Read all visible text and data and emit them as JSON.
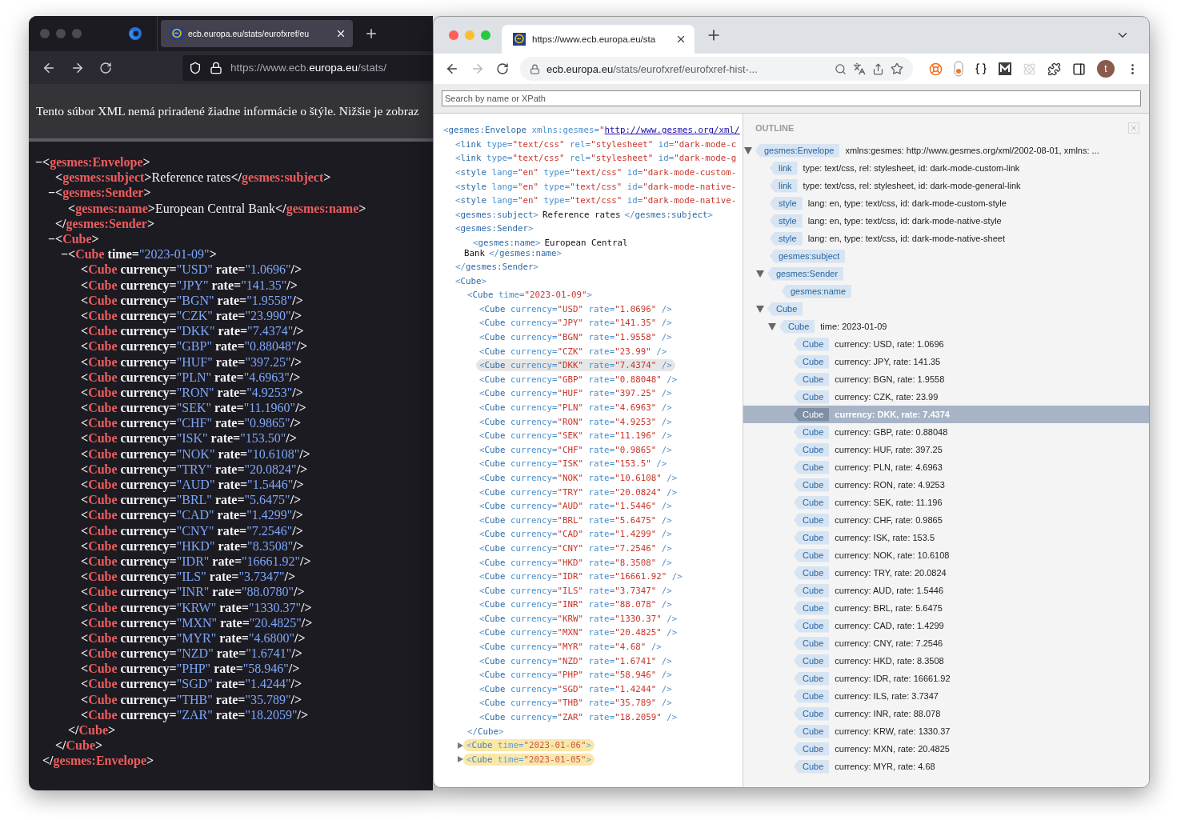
{
  "firefox": {
    "tab_title": "ecb.europa.eu/stats/eurofxref/eu",
    "url": {
      "prefix": "https://www.ecb.",
      "domain": "europa.eu",
      "suffix": "/stats/"
    },
    "notice": "Tento súbor XML nemá priradené žiadne informácie o štýle. Nižšie je zobraz",
    "xml": {
      "toggle": "−",
      "line": "<gesmes:Envelope>",
      "close": "</gesmes:Envelope>",
      "children": [
        {
          "line": "<gesmes:subject>Reference rates</gesmes:subject>"
        },
        {
          "toggle": "−",
          "line": "<gesmes:Sender>",
          "close": "</gesmes:Sender>",
          "children": [
            {
              "line": "<gesmes:name>European Central Bank</gesmes:name>"
            }
          ]
        },
        {
          "toggle": "−",
          "line": "<Cube>",
          "close": "</Cube>",
          "children": [
            {
              "toggle": "−",
              "line": "<Cube time=\"2023-01-09\">",
              "close": "</Cube>",
              "children": [
                {
                  "line": "<Cube currency=\"USD\" rate=\"1.0696\"/>"
                },
                {
                  "line": "<Cube currency=\"JPY\" rate=\"141.35\"/>"
                },
                {
                  "line": "<Cube currency=\"BGN\" rate=\"1.9558\"/>"
                },
                {
                  "line": "<Cube currency=\"CZK\" rate=\"23.990\"/>"
                },
                {
                  "line": "<Cube currency=\"DKK\" rate=\"7.4374\"/>"
                },
                {
                  "line": "<Cube currency=\"GBP\" rate=\"0.88048\"/>"
                },
                {
                  "line": "<Cube currency=\"HUF\" rate=\"397.25\"/>"
                },
                {
                  "line": "<Cube currency=\"PLN\" rate=\"4.6963\"/>"
                },
                {
                  "line": "<Cube currency=\"RON\" rate=\"4.9253\"/>"
                },
                {
                  "line": "<Cube currency=\"SEK\" rate=\"11.1960\"/>"
                },
                {
                  "line": "<Cube currency=\"CHF\" rate=\"0.9865\"/>"
                },
                {
                  "line": "<Cube currency=\"ISK\" rate=\"153.50\"/>"
                },
                {
                  "line": "<Cube currency=\"NOK\" rate=\"10.6108\"/>"
                },
                {
                  "line": "<Cube currency=\"TRY\" rate=\"20.0824\"/>"
                },
                {
                  "line": "<Cube currency=\"AUD\" rate=\"1.5446\"/>"
                },
                {
                  "line": "<Cube currency=\"BRL\" rate=\"5.6475\"/>"
                },
                {
                  "line": "<Cube currency=\"CAD\" rate=\"1.4299\"/>"
                },
                {
                  "line": "<Cube currency=\"CNY\" rate=\"7.2546\"/>"
                },
                {
                  "line": "<Cube currency=\"HKD\" rate=\"8.3508\"/>"
                },
                {
                  "line": "<Cube currency=\"IDR\" rate=\"16661.92\"/>"
                },
                {
                  "line": "<Cube currency=\"ILS\" rate=\"3.7347\"/>"
                },
                {
                  "line": "<Cube currency=\"INR\" rate=\"88.0780\"/>"
                },
                {
                  "line": "<Cube currency=\"KRW\" rate=\"1330.37\"/>"
                },
                {
                  "line": "<Cube currency=\"MXN\" rate=\"20.4825\"/>"
                },
                {
                  "line": "<Cube currency=\"MYR\" rate=\"4.6800\"/>"
                },
                {
                  "line": "<Cube currency=\"NZD\" rate=\"1.6741\"/>"
                },
                {
                  "line": "<Cube currency=\"PHP\" rate=\"58.946\"/>"
                },
                {
                  "line": "<Cube currency=\"SGD\" rate=\"1.4244\"/>"
                },
                {
                  "line": "<Cube currency=\"THB\" rate=\"35.789\"/>"
                },
                {
                  "line": "<Cube currency=\"ZAR\" rate=\"18.2059\"/>"
                }
              ]
            }
          ]
        }
      ]
    }
  },
  "chrome": {
    "tab_title": "https://www.ecb.europa.eu/sta",
    "forward_disabled": true,
    "host": "ecb.europa.eu",
    "path": "/stats/eurofxref/eurofxref-hist-...",
    "avatar": "t",
    "search_placeholder": "Search by name or XPath",
    "source": {
      "line": "<gesmes:Envelope xmlns:gesmes=\"",
      "link": "http://www.gesmes.org/xml/",
      "children": [
        {
          "line": "<link type=\"text/css\" rel=\"stylesheet\" id=\"dark-mode-c"
        },
        {
          "line": "<link type=\"text/css\" rel=\"stylesheet\" id=\"dark-mode-g"
        },
        {
          "line": "<style lang=\"en\" type=\"text/css\" id=\"dark-mode-custom-"
        },
        {
          "line": "<style lang=\"en\" type=\"text/css\" id=\"dark-mode-native-"
        },
        {
          "line": "<style lang=\"en\" type=\"text/css\" id=\"dark-mode-native-"
        },
        {
          "open": "<gesmes:subject>",
          "text": "Reference rates",
          "close": "</gesmes:subject>"
        },
        {
          "line": "<gesmes:Sender>",
          "close": "</gesmes:Sender>",
          "children": [
            {
              "open": "<gesmes:name>",
              "text": "European Central Bank",
              "close": "</gesmes:name>"
            }
          ]
        },
        {
          "line": "<Cube>",
          "children": [
            {
              "line": "<Cube time=\"2023-01-09\">",
              "expanded": true,
              "close": "</Cube>",
              "children": [
                {
                  "line": "<Cube currency=\"USD\" rate=\"1.0696\" />",
                  "selected": false
                },
                {
                  "line": "<Cube currency=\"JPY\" rate=\"141.35\" />",
                  "selected": false
                },
                {
                  "line": "<Cube currency=\"BGN\" rate=\"1.9558\" />",
                  "selected": false
                },
                {
                  "line": "<Cube currency=\"CZK\" rate=\"23.99\" />",
                  "selected": false
                },
                {
                  "line": "<Cube currency=\"DKK\" rate=\"7.4374\" />",
                  "selected": true
                },
                {
                  "line": "<Cube currency=\"GBP\" rate=\"0.88048\" />",
                  "selected": false
                },
                {
                  "line": "<Cube currency=\"HUF\" rate=\"397.25\" />",
                  "selected": false
                },
                {
                  "line": "<Cube currency=\"PLN\" rate=\"4.6963\" />",
                  "selected": false
                },
                {
                  "line": "<Cube currency=\"RON\" rate=\"4.9253\" />",
                  "selected": false
                },
                {
                  "line": "<Cube currency=\"SEK\" rate=\"11.196\" />",
                  "selected": false
                },
                {
                  "line": "<Cube currency=\"CHF\" rate=\"0.9865\" />",
                  "selected": false
                },
                {
                  "line": "<Cube currency=\"ISK\" rate=\"153.5\" />",
                  "selected": false
                },
                {
                  "line": "<Cube currency=\"NOK\" rate=\"10.6108\" />",
                  "selected": false
                },
                {
                  "line": "<Cube currency=\"TRY\" rate=\"20.0824\" />",
                  "selected": false
                },
                {
                  "line": "<Cube currency=\"AUD\" rate=\"1.5446\" />",
                  "selected": false
                },
                {
                  "line": "<Cube currency=\"BRL\" rate=\"5.6475\" />",
                  "selected": false
                },
                {
                  "line": "<Cube currency=\"CAD\" rate=\"1.4299\" />",
                  "selected": false
                },
                {
                  "line": "<Cube currency=\"CNY\" rate=\"7.2546\" />",
                  "selected": false
                },
                {
                  "line": "<Cube currency=\"HKD\" rate=\"8.3508\" />",
                  "selected": false
                },
                {
                  "line": "<Cube currency=\"IDR\" rate=\"16661.92\" />",
                  "selected": false
                },
                {
                  "line": "<Cube currency=\"ILS\" rate=\"3.7347\" />",
                  "selected": false
                },
                {
                  "line": "<Cube currency=\"INR\" rate=\"88.078\" />",
                  "selected": false
                },
                {
                  "line": "<Cube currency=\"KRW\" rate=\"1330.37\" />",
                  "selected": false
                },
                {
                  "line": "<Cube currency=\"MXN\" rate=\"20.4825\" />",
                  "selected": false
                },
                {
                  "line": "<Cube currency=\"MYR\" rate=\"4.68\" />",
                  "selected": false
                },
                {
                  "line": "<Cube currency=\"NZD\" rate=\"1.6741\" />",
                  "selected": false
                },
                {
                  "line": "<Cube currency=\"PHP\" rate=\"58.946\" />",
                  "selected": false
                },
                {
                  "line": "<Cube currency=\"SGD\" rate=\"1.4244\" />",
                  "selected": false
                },
                {
                  "line": "<Cube currency=\"THB\" rate=\"35.789\" />",
                  "selected": false
                },
                {
                  "line": "<Cube currency=\"ZAR\" rate=\"18.2059\" />",
                  "selected": false
                }
              ]
            },
            {
              "line": "<Cube time=\"2023-01-06\">",
              "expanded": false
            },
            {
              "line": "<Cube time=\"2023-01-05\">",
              "expanded": false
            }
          ]
        }
      ]
    },
    "outline": {
      "title": "OUTLINE",
      "tree": [
        {
          "tag": "gesmes:Envelope",
          "info": "xmlns:gesmes: http://www.gesmes.org/xml/2002-08-01, xmlns: ...",
          "expanded": true,
          "children": [
            {
              "tag": "link",
              "info": "type: text/css, rel: stylesheet, id: dark-mode-custom-link"
            },
            {
              "tag": "link",
              "info": "type: text/css, rel: stylesheet, id: dark-mode-general-link"
            },
            {
              "tag": "style",
              "info": "lang: en, type: text/css, id: dark-mode-custom-style"
            },
            {
              "tag": "style",
              "info": "lang: en, type: text/css, id: dark-mode-native-style"
            },
            {
              "tag": "style",
              "info": "lang: en, type: text/css, id: dark-mode-native-sheet"
            },
            {
              "tag": "gesmes:subject"
            },
            {
              "tag": "gesmes:Sender",
              "expanded": true,
              "children": [
                {
                  "tag": "gesmes:name"
                }
              ]
            },
            {
              "tag": "Cube",
              "expanded": true,
              "children": [
                {
                  "tag": "Cube",
                  "info": "time: 2023-01-09",
                  "expanded": true,
                  "children": [
                    {
                      "tag": "Cube",
                      "info": "currency: USD, rate: 1.0696",
                      "selected": false
                    },
                    {
                      "tag": "Cube",
                      "info": "currency: JPY, rate: 141.35",
                      "selected": false
                    },
                    {
                      "tag": "Cube",
                      "info": "currency: BGN, rate: 1.9558",
                      "selected": false
                    },
                    {
                      "tag": "Cube",
                      "info": "currency: CZK, rate: 23.99",
                      "selected": false
                    },
                    {
                      "tag": "Cube",
                      "info": "currency: DKK, rate: 7.4374",
                      "selected": true
                    },
                    {
                      "tag": "Cube",
                      "info": "currency: GBP, rate: 0.88048",
                      "selected": false
                    },
                    {
                      "tag": "Cube",
                      "info": "currency: HUF, rate: 397.25",
                      "selected": false
                    },
                    {
                      "tag": "Cube",
                      "info": "currency: PLN, rate: 4.6963",
                      "selected": false
                    },
                    {
                      "tag": "Cube",
                      "info": "currency: RON, rate: 4.9253",
                      "selected": false
                    },
                    {
                      "tag": "Cube",
                      "info": "currency: SEK, rate: 11.196",
                      "selected": false
                    },
                    {
                      "tag": "Cube",
                      "info": "currency: CHF, rate: 0.9865",
                      "selected": false
                    },
                    {
                      "tag": "Cube",
                      "info": "currency: ISK, rate: 153.5",
                      "selected": false
                    },
                    {
                      "tag": "Cube",
                      "info": "currency: NOK, rate: 10.6108",
                      "selected": false
                    },
                    {
                      "tag": "Cube",
                      "info": "currency: TRY, rate: 20.0824",
                      "selected": false
                    },
                    {
                      "tag": "Cube",
                      "info": "currency: AUD, rate: 1.5446",
                      "selected": false
                    },
                    {
                      "tag": "Cube",
                      "info": "currency: BRL, rate: 5.6475",
                      "selected": false
                    },
                    {
                      "tag": "Cube",
                      "info": "currency: CAD, rate: 1.4299",
                      "selected": false
                    },
                    {
                      "tag": "Cube",
                      "info": "currency: CNY, rate: 7.2546",
                      "selected": false
                    },
                    {
                      "tag": "Cube",
                      "info": "currency: HKD, rate: 8.3508",
                      "selected": false
                    },
                    {
                      "tag": "Cube",
                      "info": "currency: IDR, rate: 16661.92",
                      "selected": false
                    },
                    {
                      "tag": "Cube",
                      "info": "currency: ILS, rate: 3.7347",
                      "selected": false
                    },
                    {
                      "tag": "Cube",
                      "info": "currency: INR, rate: 88.078",
                      "selected": false
                    },
                    {
                      "tag": "Cube",
                      "info": "currency: KRW, rate: 1330.37",
                      "selected": false
                    },
                    {
                      "tag": "Cube",
                      "info": "currency: MXN, rate: 20.4825",
                      "selected": false
                    },
                    {
                      "tag": "Cube",
                      "info": "currency: MYR, rate: 4.68",
                      "selected": false
                    }
                  ]
                }
              ]
            }
          ]
        }
      ]
    }
  }
}
